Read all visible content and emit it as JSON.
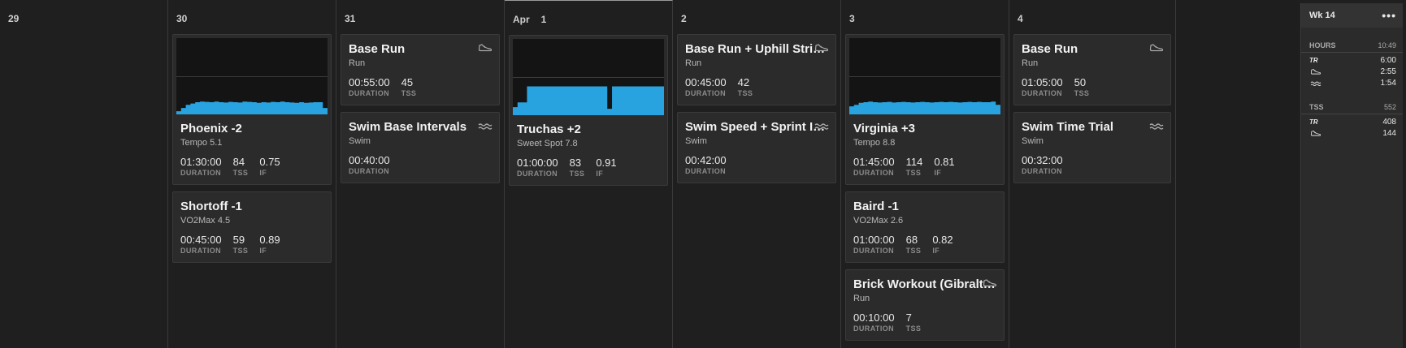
{
  "colors": {
    "accent": "#29a3e0",
    "background": "#1f1f1f",
    "card": "#2b2b2b"
  },
  "days": [
    {
      "date": "29",
      "workouts": []
    },
    {
      "date": "30",
      "workouts": [
        {
          "title": "Phoenix -2",
          "subtitle": "Tempo 5.1",
          "graph": "profile_a",
          "sport": "",
          "metrics": [
            {
              "value": "01:30:00",
              "label": "DURATION"
            },
            {
              "value": "84",
              "label": "TSS"
            },
            {
              "value": "0.75",
              "label": "IF"
            }
          ]
        },
        {
          "title": "Shortoff -1",
          "subtitle": "VO2Max 4.5",
          "graph": "",
          "sport": "",
          "metrics": [
            {
              "value": "00:45:00",
              "label": "DURATION"
            },
            {
              "value": "59",
              "label": "TSS"
            },
            {
              "value": "0.89",
              "label": "IF"
            }
          ]
        }
      ]
    },
    {
      "date": "31",
      "workouts": [
        {
          "title": "Base Run",
          "subtitle": "Run",
          "graph": "",
          "sport": "run-shoe-icon",
          "metrics": [
            {
              "value": "00:55:00",
              "label": "DURATION"
            },
            {
              "value": "45",
              "label": "TSS"
            }
          ]
        },
        {
          "title": "Swim Base Intervals",
          "subtitle": "Swim",
          "graph": "",
          "sport": "swim-waves-icon",
          "metrics": [
            {
              "value": "00:40:00",
              "label": "DURATION"
            }
          ]
        }
      ]
    },
    {
      "month": "Apr",
      "date": "1",
      "today": true,
      "workouts": [
        {
          "title": "Truchas +2",
          "subtitle": "Sweet Spot 7.8",
          "graph": "profile_b",
          "sport": "",
          "metrics": [
            {
              "value": "01:00:00",
              "label": "DURATION"
            },
            {
              "value": "83",
              "label": "TSS"
            },
            {
              "value": "0.91",
              "label": "IF"
            }
          ]
        }
      ]
    },
    {
      "date": "2",
      "workouts": [
        {
          "title": "Base Run + Uphill Strides",
          "subtitle": "Run",
          "graph": "",
          "sport": "run-shoe-icon",
          "metrics": [
            {
              "value": "00:45:00",
              "label": "DURATION"
            },
            {
              "value": "42",
              "label": "TSS"
            }
          ]
        },
        {
          "title": "Swim Speed + Sprint Intervals",
          "subtitle": "Swim",
          "graph": "",
          "sport": "swim-waves-icon",
          "metrics": [
            {
              "value": "00:42:00",
              "label": "DURATION"
            }
          ]
        }
      ]
    },
    {
      "date": "3",
      "workouts": [
        {
          "title": "Virginia +3",
          "subtitle": "Tempo 8.8",
          "graph": "profile_c",
          "sport": "",
          "metrics": [
            {
              "value": "01:45:00",
              "label": "DURATION"
            },
            {
              "value": "114",
              "label": "TSS"
            },
            {
              "value": "0.81",
              "label": "IF"
            }
          ]
        },
        {
          "title": "Baird -1",
          "subtitle": "VO2Max 2.6",
          "graph": "",
          "sport": "",
          "metrics": [
            {
              "value": "01:00:00",
              "label": "DURATION"
            },
            {
              "value": "68",
              "label": "TSS"
            },
            {
              "value": "0.82",
              "label": "IF"
            }
          ]
        },
        {
          "title": "Brick Workout (Gibraltar)",
          "subtitle": "Run",
          "graph": "",
          "sport": "run-shoe-icon",
          "metrics": [
            {
              "value": "00:10:00",
              "label": "DURATION"
            },
            {
              "value": "7",
              "label": "TSS"
            }
          ]
        }
      ]
    },
    {
      "date": "4",
      "workouts": [
        {
          "title": "Base Run",
          "subtitle": "Run",
          "graph": "",
          "sport": "run-shoe-icon",
          "metrics": [
            {
              "value": "01:05:00",
              "label": "DURATION"
            },
            {
              "value": "50",
              "label": "TSS"
            }
          ]
        },
        {
          "title": "Swim Time Trial",
          "subtitle": "Swim",
          "graph": "",
          "sport": "swim-waves-icon",
          "metrics": [
            {
              "value": "00:32:00",
              "label": "DURATION"
            }
          ]
        }
      ]
    }
  ],
  "profiles": {
    "profile_a": [
      0.1,
      0.2,
      0.3,
      0.34,
      0.38,
      0.4,
      0.39,
      0.38,
      0.4,
      0.38,
      0.37,
      0.39,
      0.38,
      0.37,
      0.4,
      0.39,
      0.38,
      0.36,
      0.38,
      0.37,
      0.39,
      0.38,
      0.4,
      0.38,
      0.37,
      0.36,
      0.38,
      0.36,
      0.37,
      0.38,
      0.38,
      0.2
    ],
    "profile_b": [
      0.25,
      0.4,
      0.4,
      0.9,
      0.9,
      0.9,
      0.9,
      0.9,
      0.9,
      0.9,
      0.9,
      0.9,
      0.9,
      0.9,
      0.9,
      0.9,
      0.9,
      0.9,
      0.9,
      0.9,
      0.2,
      0.9,
      0.9,
      0.9,
      0.9,
      0.9,
      0.9,
      0.9,
      0.9,
      0.9,
      0.9,
      0.9
    ],
    "profile_c": [
      0.25,
      0.3,
      0.36,
      0.38,
      0.4,
      0.38,
      0.37,
      0.38,
      0.39,
      0.37,
      0.38,
      0.39,
      0.38,
      0.37,
      0.38,
      0.39,
      0.38,
      0.37,
      0.38,
      0.39,
      0.38,
      0.39,
      0.38,
      0.37,
      0.38,
      0.39,
      0.38,
      0.39,
      0.38,
      0.38,
      0.4,
      0.3
    ]
  },
  "summary": {
    "week": "Wk 14",
    "menu": "•••",
    "hours": {
      "label": "HOURS",
      "total": "10:49",
      "rows": [
        {
          "icon": "tr-logo-icon",
          "value": "6:00"
        },
        {
          "icon": "run-shoe-icon",
          "value": "2:55"
        },
        {
          "icon": "swim-waves-icon",
          "value": "1:54"
        }
      ]
    },
    "tss": {
      "label": "TSS",
      "total": "552",
      "rows": [
        {
          "icon": "tr-logo-icon",
          "value": "408"
        },
        {
          "icon": "run-shoe-icon",
          "value": "144"
        }
      ]
    }
  }
}
